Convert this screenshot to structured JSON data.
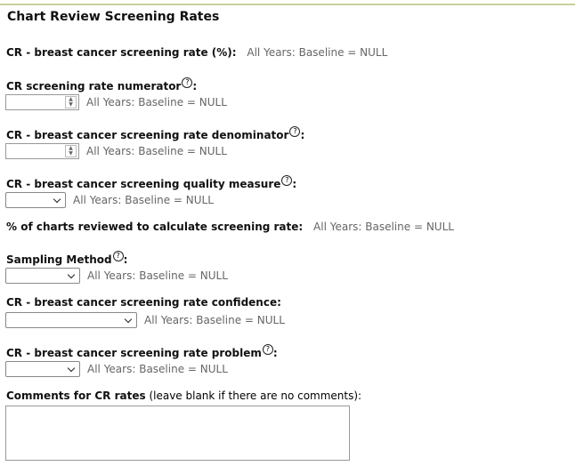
{
  "page": {
    "title": "Chart Review Screening Rates"
  },
  "fields": {
    "rate": {
      "label": "CR - breast cancer screening rate (%):",
      "note": "All Years: Baseline = NULL"
    },
    "numerator": {
      "label": "CR screening rate numerator",
      "note": "All Years: Baseline = NULL",
      "value": ""
    },
    "denominator": {
      "label": "CR - breast cancer screening rate denominator",
      "note": "All Years: Baseline = NULL",
      "value": ""
    },
    "quality": {
      "label": "CR - breast cancer screening quality measure",
      "note": "All Years: Baseline = NULL",
      "selected": ""
    },
    "percent_reviewed": {
      "label": "% of charts reviewed to calculate screening rate:",
      "note": "All Years: Baseline = NULL"
    },
    "sampling": {
      "label": "Sampling Method",
      "note": "All Years: Baseline = NULL",
      "selected": ""
    },
    "confidence": {
      "label": "CR - breast cancer screening rate confidence:",
      "note": "All Years: Baseline = NULL",
      "selected": ""
    },
    "problem": {
      "label": "CR - breast cancer screening rate problem",
      "note": "All Years: Baseline = NULL",
      "selected": ""
    },
    "comments": {
      "label": "Comments for CR rates",
      "hint": "(leave blank if there are no comments):",
      "value": ""
    }
  },
  "icons": {
    "help": "question-circle-icon",
    "spin": "spinner-arrows-icon",
    "dropdown": "chevron-down-icon"
  },
  "colors": {
    "rule": "#c9cf9b",
    "note_text": "#666666"
  }
}
